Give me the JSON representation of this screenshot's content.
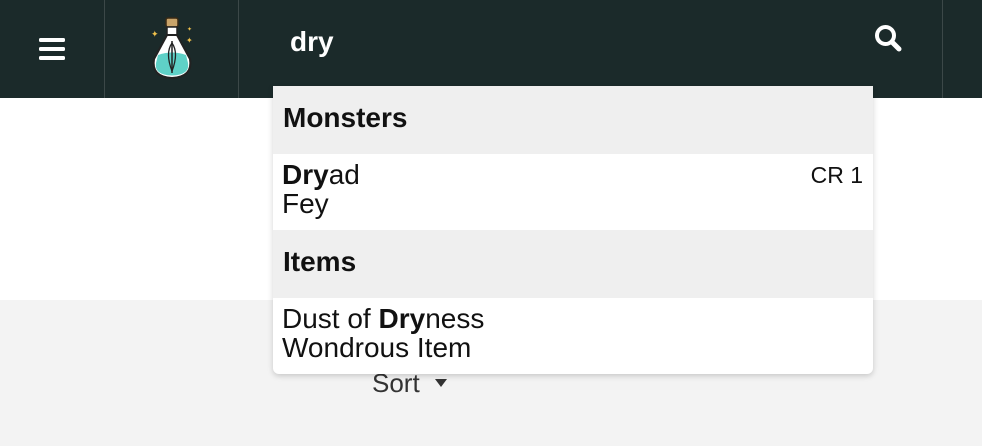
{
  "header": {
    "search_value": "dry"
  },
  "icons": {
    "menu": "hamburger-menu-icon",
    "logo": "potion-bottle-icon",
    "search": "magnifier-icon",
    "sort": "caret-down-icon"
  },
  "colors": {
    "topbar": "#1b2a2a",
    "dropdown_header": "#efefef",
    "lower_panel": "#f3f3f3",
    "potion_liquid": "#5fd1c7"
  },
  "dropdown": {
    "groups": [
      {
        "title": "Monsters",
        "results": [
          {
            "match": "Dry",
            "rest_after": "ad",
            "prefix": "",
            "type": "Fey",
            "meta": "CR 1"
          }
        ]
      },
      {
        "title": "Items",
        "results": [
          {
            "prefix": "Dust of ",
            "match": "Dry",
            "rest_after": "ness",
            "type": "Wondrous Item",
            "meta": ""
          }
        ]
      }
    ]
  },
  "toolbar": {
    "sort_label": "Sort"
  }
}
